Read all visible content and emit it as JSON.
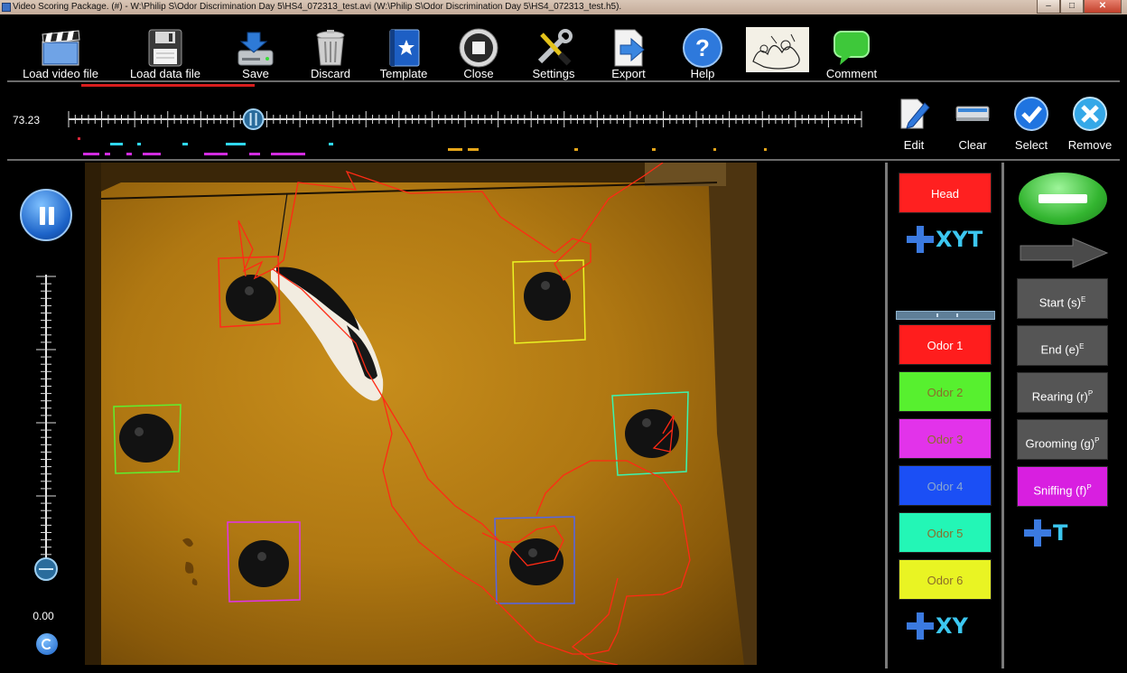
{
  "window": {
    "title": "Video Scoring Package. (#) - W:\\Philip S\\Odor Discrimination Day 5\\HS4_072313_test.avi (W:\\Philip S\\Odor Discrimination Day 5\\HS4_072313_test.h5).",
    "controls": [
      "–",
      "□",
      "✕"
    ]
  },
  "toolbar": [
    {
      "label": "Load video file",
      "icon": "clapperboard-icon"
    },
    {
      "label": "Load data file",
      "icon": "floppy-disk-icon"
    },
    {
      "label": "Save",
      "icon": "hard-drive-save-icon"
    },
    {
      "label": "Discard",
      "icon": "trash-can-icon"
    },
    {
      "label": "Template",
      "icon": "template-book-icon"
    },
    {
      "label": "Close",
      "icon": "stop-circle-icon"
    },
    {
      "label": "Settings",
      "icon": "wrench-screwdriver-icon"
    },
    {
      "label": "Export",
      "icon": "export-document-icon"
    },
    {
      "label": "Help",
      "icon": "help-question-icon"
    },
    {
      "label": "",
      "icon": "cartoon-image-icon"
    },
    {
      "label": "Comment",
      "icon": "speech-bubble-icon"
    }
  ],
  "timeline": {
    "current_time": "73.23",
    "playhead_fraction": 0.233,
    "edit_tools": [
      {
        "label": "Edit",
        "icon": "edit-pencil-icon"
      },
      {
        "label": "Clear",
        "icon": "eraser-icon"
      },
      {
        "label": "Select",
        "icon": "checkmark-icon"
      },
      {
        "label": "Remove",
        "icon": "remove-x-icon"
      }
    ]
  },
  "playback": {
    "pause_icon": "pause-icon",
    "speed_value": "0.00",
    "speed_fraction": 0.0,
    "reset_icon": "reset-icon"
  },
  "roi_panel": {
    "head": {
      "label": "Head",
      "color": "#ff2020",
      "text_color": "#ffffff"
    },
    "add_xyt": "XYT",
    "odors": [
      {
        "label": "Odor 1",
        "color": "#ff1d1d",
        "text_color": "#ffffff"
      },
      {
        "label": "Odor 2",
        "color": "#57f02f",
        "text_color": "#8b6d2a"
      },
      {
        "label": "Odor 3",
        "color": "#e233ea",
        "text_color": "#8b6d2a"
      },
      {
        "label": "Odor 4",
        "color": "#1b4ff5",
        "text_color": "#8ba8d0"
      },
      {
        "label": "Odor 5",
        "color": "#23f6b6",
        "text_color": "#8b6d2a"
      },
      {
        "label": "Odor 6",
        "color": "#e9f423",
        "text_color": "#8b6d2a"
      }
    ],
    "add_xy": "XY"
  },
  "behavior_panel": {
    "minus_icon": "minus-icon",
    "arrow_icon": "next-arrow-icon",
    "behaviors": [
      {
        "label": "Start (s)",
        "sup": "E",
        "color": "#555555"
      },
      {
        "label": "End (e)",
        "sup": "E",
        "color": "#555555"
      },
      {
        "label": "Rearing (r)",
        "sup": "P",
        "color": "#555555"
      },
      {
        "label": "Grooming (g)",
        "sup": "P",
        "color": "#555555"
      },
      {
        "label": "Sniffing (f)",
        "sup": "P",
        "color": "#d81fe0"
      }
    ],
    "add_t": "T"
  },
  "video": {
    "trajectory_color": "#ff2a14"
  }
}
